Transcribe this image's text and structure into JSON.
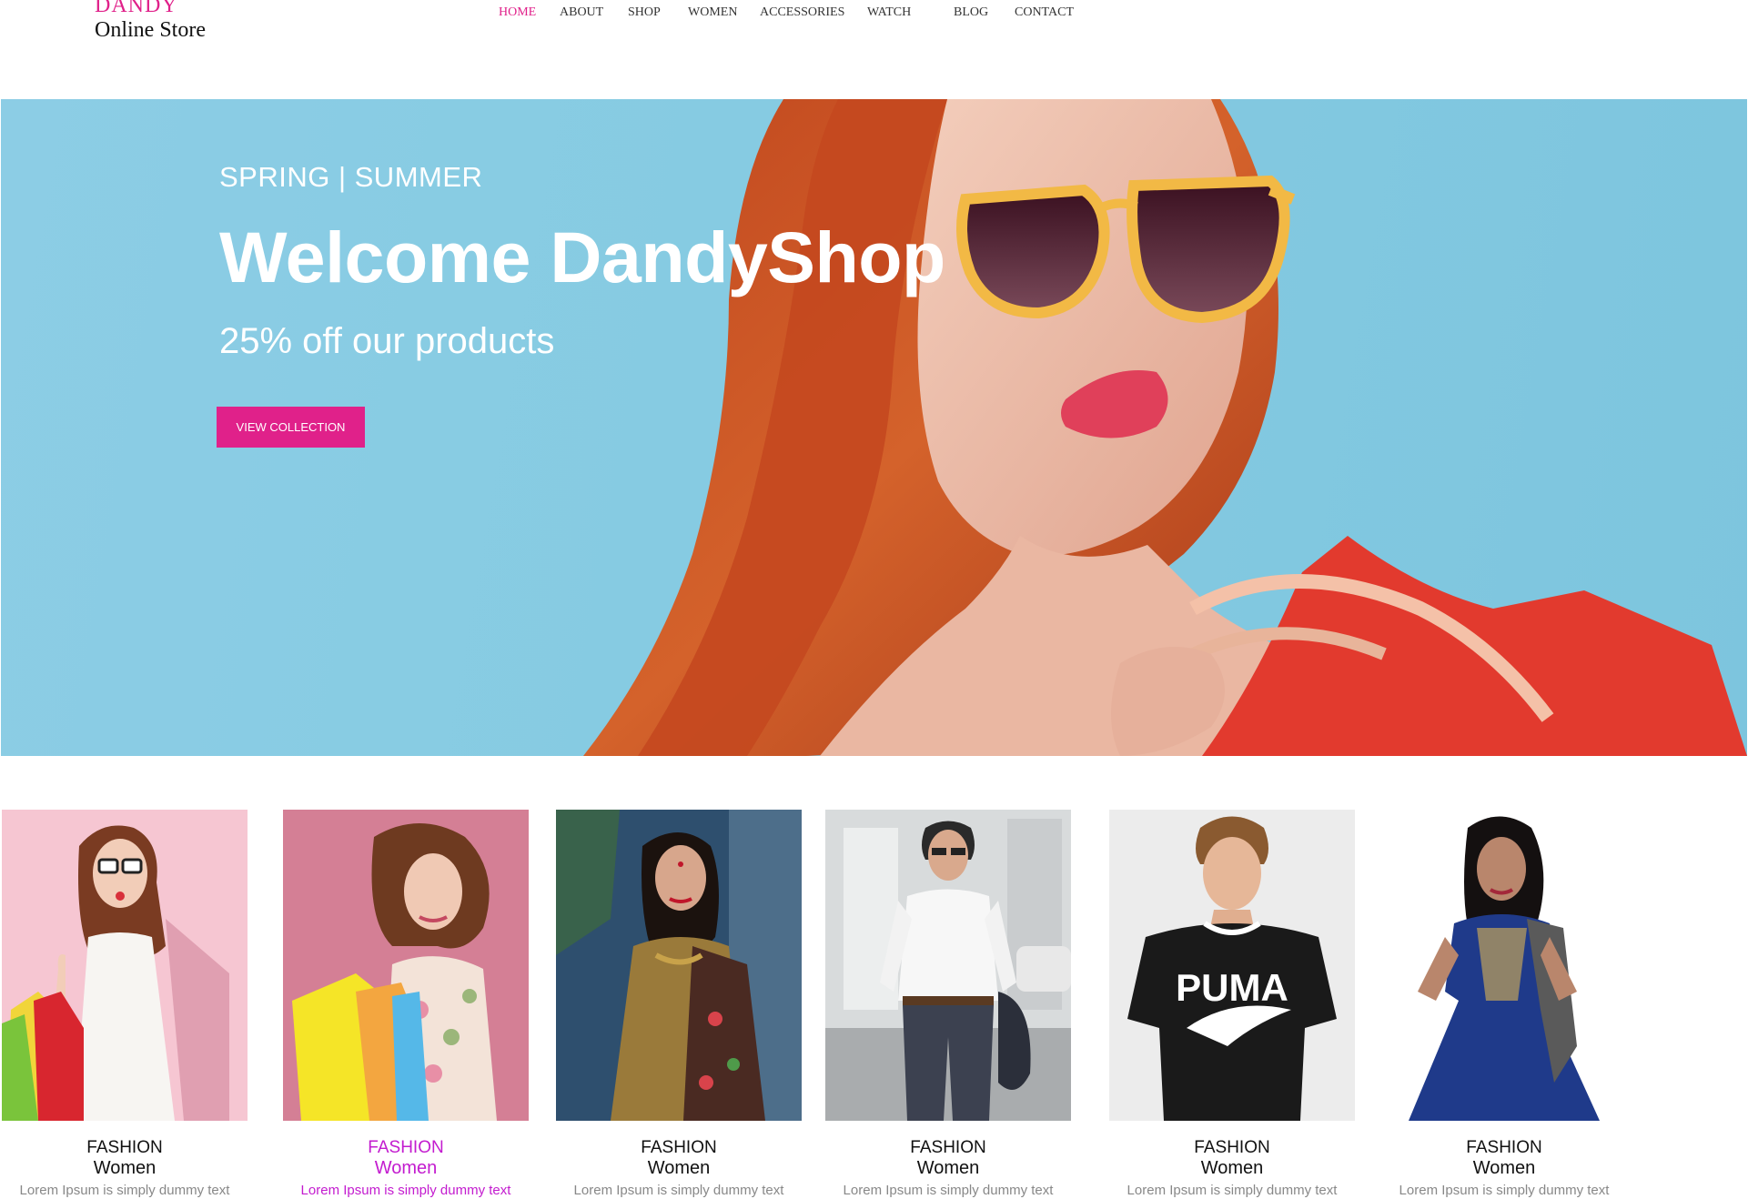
{
  "brand": {
    "name_top": "DANDY",
    "name_bottom": "Online Store",
    "accent": "#e0218a"
  },
  "nav": {
    "items": [
      "HOME",
      "ABOUT",
      "SHOP",
      "WOMEN",
      "ACCESSORIES",
      "WATCH",
      "BLOG",
      "CONTACT"
    ],
    "active": "HOME"
  },
  "hero": {
    "subtitle": "SPRING | SUMMER",
    "title": "Welcome DandyShop",
    "offer": "25% off  our products",
    "button": "VIEW COLLECTION",
    "background": "#86cbe2"
  },
  "products": [
    {
      "category": "FASHION",
      "name": "Women",
      "desc": "Lorem Ipsum is simply dummy text",
      "highlighted": false,
      "photo": "woman-sunglasses-shopping-bags"
    },
    {
      "category": "FASHION",
      "name": "Women",
      "desc": "Lorem Ipsum is simply dummy text",
      "highlighted": true,
      "photo": "woman-curly-hair-shopping-bags"
    },
    {
      "category": "FASHION",
      "name": "Women",
      "desc": "Lorem Ipsum is simply dummy text",
      "highlighted": false,
      "photo": "woman-saree"
    },
    {
      "category": "FASHION",
      "name": "Women",
      "desc": "Lorem Ipsum is simply dummy text",
      "highlighted": false,
      "photo": "man-white-shirt"
    },
    {
      "category": "FASHION",
      "name": "Women",
      "desc": "Lorem Ipsum is simply dummy text",
      "highlighted": false,
      "photo": "man-puma-tshirt"
    },
    {
      "category": "FASHION",
      "name": "Women",
      "desc": "Lorem Ipsum is simply dummy text",
      "highlighted": false,
      "photo": "woman-blue-dress"
    }
  ],
  "colors": {
    "highlight": "#c31ccf",
    "muted": "#888888"
  }
}
